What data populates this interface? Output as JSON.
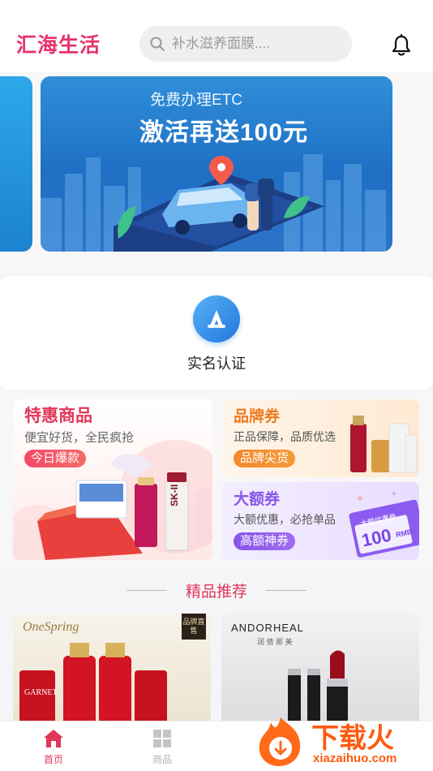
{
  "header": {
    "logo": "汇海生活",
    "search_placeholder": "补水滋养面膜...."
  },
  "banner": {
    "line1": "免费办理ETC",
    "line2": "激活再送100元"
  },
  "verify": {
    "label": "实名认证"
  },
  "promos": {
    "big": {
      "title": "特惠商品",
      "subtitle": "便宜好货，全民疯抢",
      "tag": "今日爆款",
      "product_brand": "SK-II"
    },
    "brand": {
      "title": "品牌券",
      "subtitle": "正品保障，品质优选",
      "tag": "品牌尖货",
      "color": "#f07a1e"
    },
    "big_coupon": {
      "title": "大额券",
      "subtitle": "大额优惠，必抢单品",
      "tag": "高额神券",
      "color": "#8756e8",
      "ticket_label": "大额优惠券",
      "ticket_value": "100",
      "ticket_unit": "RMB"
    }
  },
  "recommend": {
    "title": "精品推荐",
    "products": [
      {
        "brand": "OneSpring",
        "ribbon": "品牌直售",
        "label": "GARNET"
      },
      {
        "brand": "ANDORHEAL",
        "brand_sub": "润 倩 那 美"
      }
    ]
  },
  "nav": {
    "items": [
      {
        "label": "首页",
        "active": true,
        "color": "#e2365b"
      },
      {
        "label": "商品",
        "active": false,
        "color": "#b0b0b0"
      }
    ]
  },
  "watermark": {
    "text": "下载火",
    "url": "xiazaihuo.com"
  },
  "colors": {
    "accent": "#e2365b",
    "banner_blue": "#1f6fc4"
  }
}
